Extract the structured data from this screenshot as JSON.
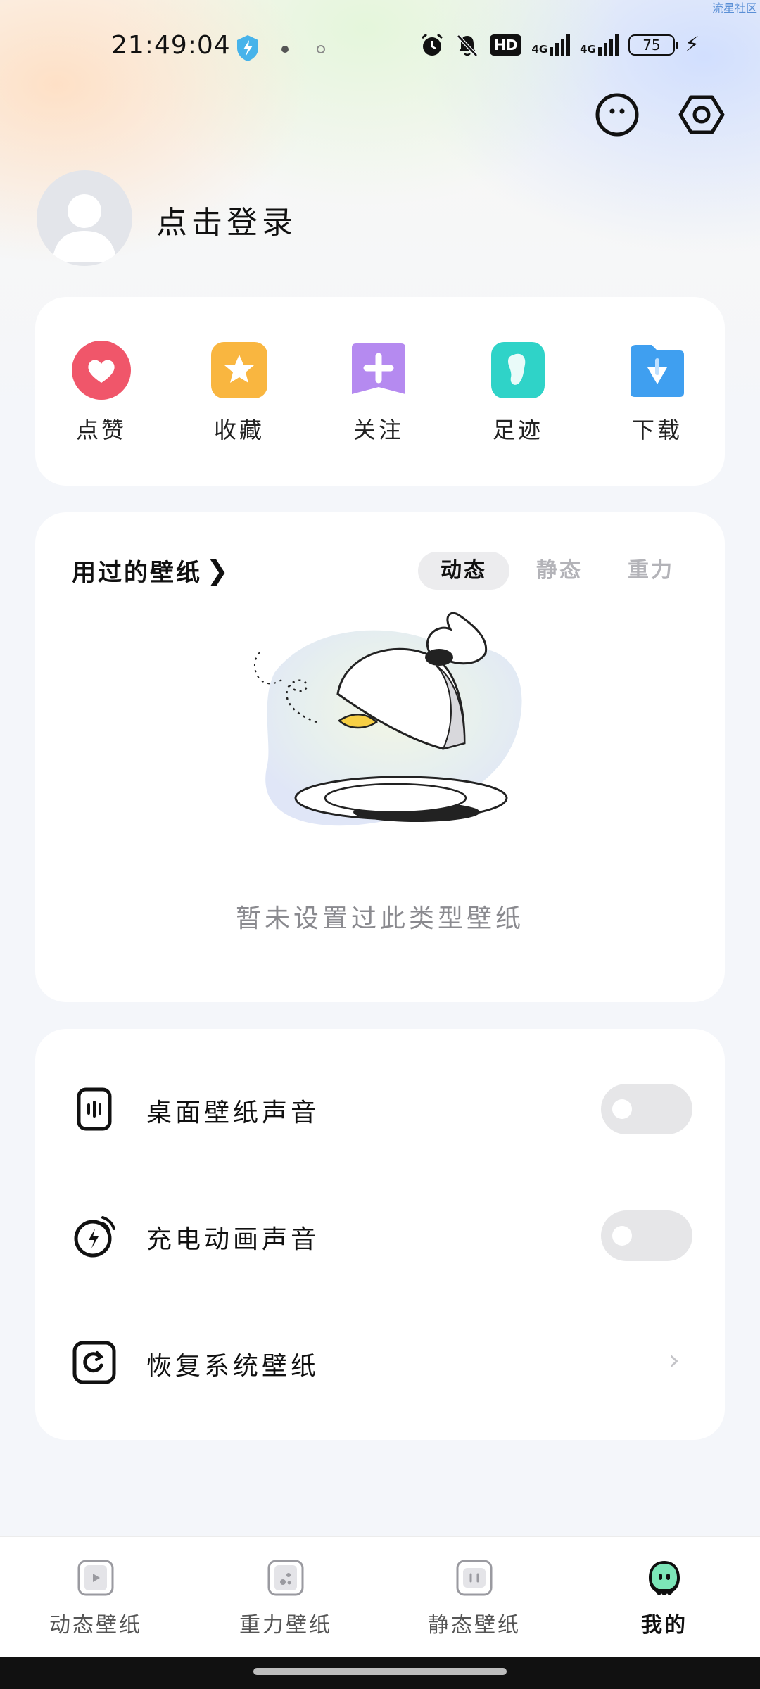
{
  "watermark": "流星社区",
  "status_bar": {
    "time": "21:49:04",
    "hd_label": "HD",
    "net1": "4G",
    "net2": "4G",
    "battery": "75"
  },
  "profile": {
    "login_text": "点击登录"
  },
  "quick_actions": [
    {
      "label": "点赞",
      "icon": "heart-icon"
    },
    {
      "label": "收藏",
      "icon": "star-icon"
    },
    {
      "label": "关注",
      "icon": "plus-icon"
    },
    {
      "label": "足迹",
      "icon": "footprint-icon"
    },
    {
      "label": "下载",
      "icon": "download-icon"
    }
  ],
  "history": {
    "title": "用过的壁纸",
    "tabs": [
      "动态",
      "静态",
      "重力"
    ],
    "active_tab": "动态",
    "empty_text": "暂未设置过此类型壁纸"
  },
  "settings": [
    {
      "label": "桌面壁纸声音",
      "type": "toggle",
      "on": false
    },
    {
      "label": "充电动画声音",
      "type": "toggle",
      "on": false
    },
    {
      "label": "恢复系统壁纸",
      "type": "link"
    }
  ],
  "bottom_nav": [
    {
      "label": "动态壁纸",
      "active": false
    },
    {
      "label": "重力壁纸",
      "active": false
    },
    {
      "label": "静态壁纸",
      "active": false
    },
    {
      "label": "我的",
      "active": true
    }
  ],
  "colors": {
    "like": "#f0566a",
    "collect": "#f9b640",
    "follow": "#b58af0",
    "footprint": "#2fd3c8",
    "download": "#3f9ff0"
  }
}
